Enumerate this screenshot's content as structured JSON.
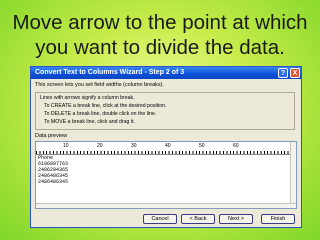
{
  "slide": {
    "title": "Move arrow to the point at which you want to divide the data."
  },
  "dialog": {
    "title": "Convert Text to Columns Wizard - Step 2 of 3",
    "help_label": "?",
    "close_label": "X",
    "intro": "This screen lets you set field widths (column breaks).",
    "instructions": {
      "lead": "Lines with arrows signify a column break.",
      "lines": [
        "To CREATE a break line, click at the desired position.",
        "To DELETE a break line, double click on the line.",
        "To MOVE a break line, click and drag it."
      ]
    },
    "preview_label": "Data preview",
    "ruler_ticks": [
      "10",
      "20",
      "30",
      "40",
      "50",
      "60"
    ],
    "preview_rows": [
      "Phone",
      "6106897763",
      "2486294365",
      "2486486345",
      "2486486345"
    ],
    "buttons": {
      "cancel": "Cancel",
      "back": "< Back",
      "next": "Next >",
      "finish": "Finish"
    }
  }
}
